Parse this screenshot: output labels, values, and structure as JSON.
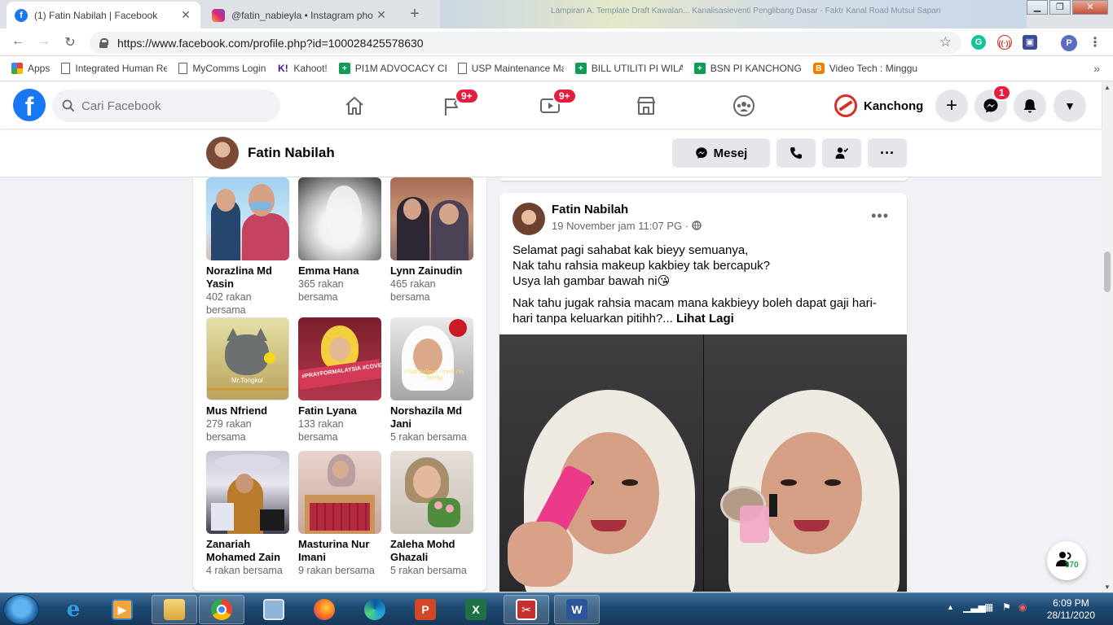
{
  "browser": {
    "tabs": [
      {
        "title": "(1) Fatin Nabilah | Facebook",
        "active": true
      },
      {
        "title": "@fatin_nabieyla • Instagram pho",
        "active": false
      }
    ],
    "background_tab_text": "Lampiran A. Template Draft Kawalan... Kanalisasieventi Penglibang Dasar - Faktr Kanal Road Mutsul Sapari",
    "url": "https://www.facebook.com/profile.php?id=100028425578630",
    "bookmarks": [
      {
        "label": "Apps",
        "icon": "apps-grid-icon"
      },
      {
        "label": "Integrated Human Re",
        "icon": "page-icon"
      },
      {
        "label": "MyComms Login",
        "icon": "page-icon"
      },
      {
        "label": "Kahoot!",
        "icon": "kahoot-icon"
      },
      {
        "label": "PI1M ADVOCACY CE",
        "icon": "sheets-icon"
      },
      {
        "label": "USP Maintenance Ma",
        "icon": "page-icon"
      },
      {
        "label": "BILL UTILITI PI WILAY",
        "icon": "sheets-icon"
      },
      {
        "label": "BSN PI KANCHONG D",
        "icon": "sheets-icon"
      },
      {
        "label": "Video Tech : Minggu",
        "icon": "blogger-icon"
      }
    ],
    "profile_initial": "P"
  },
  "fb": {
    "search_placeholder": "Cari Facebook",
    "groups_badge": "9+",
    "watch_badge": "9+",
    "messenger_badge": "1",
    "user_name": "Kanchong",
    "colors": {
      "brand": "#1877f2",
      "badge": "#e41e3f"
    }
  },
  "profile": {
    "name": "Fatin Nabilah",
    "message_label": "Mesej"
  },
  "friends": [
    {
      "name": "Norazlina Md Yasin",
      "mutual": "402 rakan bersama"
    },
    {
      "name": "Emma Hana",
      "mutual": "365 rakan bersama"
    },
    {
      "name": "Lynn Zainudin",
      "mutual": "465 rakan bersama"
    },
    {
      "name": "Mus Nfriend",
      "mutual": "279 rakan bersama"
    },
    {
      "name": "Fatin Lyana",
      "mutual": "133 rakan bersama"
    },
    {
      "name": "Norshazila Md Jani",
      "mutual": "5 rakan bersama"
    },
    {
      "name": "Zanariah Mohamed Zain",
      "mutual": "4 rakan bersama"
    },
    {
      "name": "Masturina Nur Imani",
      "mutual": "9 rakan bersama"
    },
    {
      "name": "Zaleha Mohd Ghazali",
      "mutual": "5 rakan bersama"
    }
  ],
  "photo_captions": {
    "mus": "Mr.Tongkol",
    "fatin_banner": "#PRAYFORMALAYSIA #COVID19",
    "norshazila": "I Still Believe I think I'm Strong"
  },
  "post": {
    "author": "Fatin Nabilah",
    "meta": "19 November jam 11:07 PG ·",
    "line1": "Selamat pagi sahabat kak bieyy semuanya,",
    "line2": "Nak tahu rahsia makeup kakbiey tak bercapuk?",
    "line3": "Usya lah gambar bawah ni😘",
    "para2": "Nak tahu jugak rahsia macam mana kakbieyy boleh dapat gaji hari-hari tanpa keluarkan pitihh?...",
    "see_more": "Lihat Lagi"
  },
  "chat": {
    "count": "370"
  },
  "taskbar": {
    "time": "6:09 PM",
    "date": "28/11/2020"
  }
}
